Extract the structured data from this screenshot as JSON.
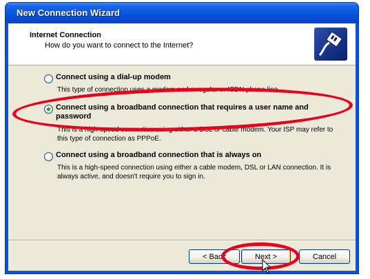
{
  "window": {
    "title": "New Connection Wizard"
  },
  "header": {
    "title": "Internet Connection",
    "subtitle": "How do you want to connect to the Internet?",
    "icon": "network-cable-icon"
  },
  "options": [
    {
      "label": "Connect using a dial-up modem",
      "description": "This type of connection uses a modem and a regular or ISDN phone line.",
      "selected": false
    },
    {
      "label": "Connect using a broadband connection that requires a user name and password",
      "description": "This is a high-speed connection using either a DSL or cable modem. Your ISP may refer to this type of connection as PPPoE.",
      "selected": true
    },
    {
      "label": "Connect using a broadband connection that is always on",
      "description": "This is a high-speed connection using either a cable modem, DSL or LAN connection. It is always active, and doesn't require you to sign in.",
      "selected": false
    }
  ],
  "buttons": {
    "back": "< Back",
    "next": "Next >",
    "cancel": "Cancel"
  },
  "colors": {
    "titlebar": "#0a54d8",
    "annotation": "#e8001c",
    "dialog_bg": "#ece9d8"
  }
}
